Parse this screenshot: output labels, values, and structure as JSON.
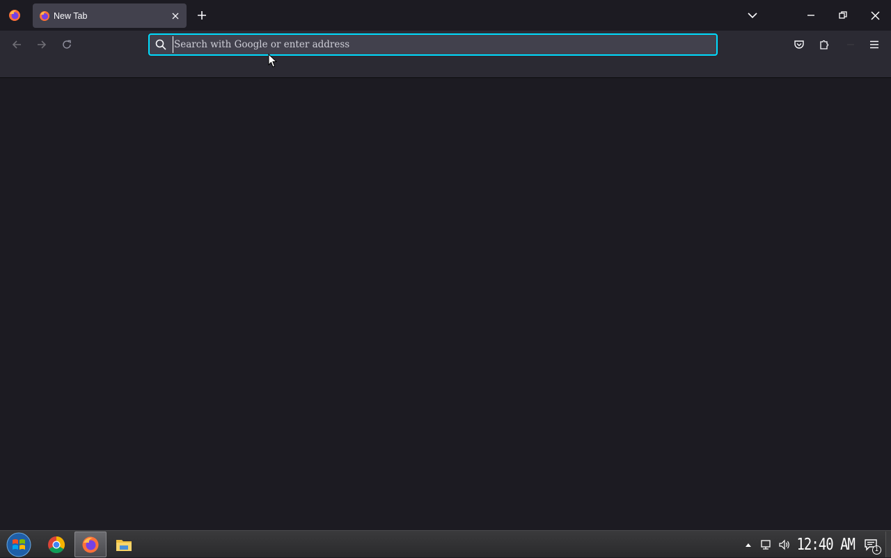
{
  "browser": {
    "tab": {
      "title": "New Tab"
    },
    "urlbar": {
      "value": "",
      "placeholder": "Search with Google or enter address"
    }
  },
  "taskbar": {
    "apps": [
      "Google Chrome",
      "Firefox",
      "File Explorer"
    ],
    "clock": "12:40 AM",
    "notification_count": "1"
  },
  "colors": {
    "accent_focus": "#00ddff",
    "toolbar": "#2b2a33",
    "background": "#1c1b22"
  }
}
